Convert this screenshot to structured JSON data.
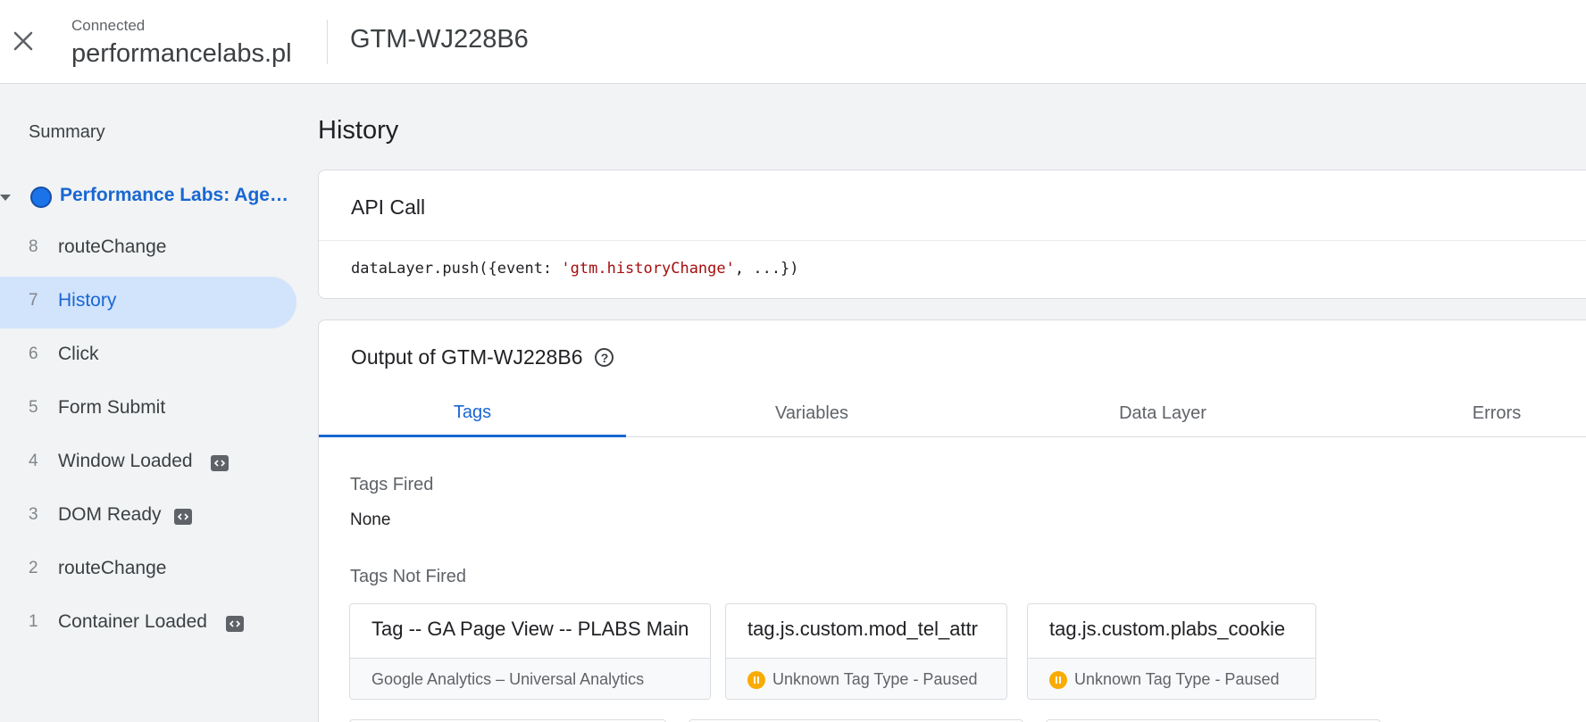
{
  "header": {
    "status": "Connected",
    "site": "performancelabs.pl",
    "container_id": "GTM-WJ228B6"
  },
  "sidebar": {
    "summary": "Summary",
    "page": "Performance Labs: Agencja Performance Marketingu",
    "events": [
      {
        "num": "8",
        "label": "routeChange"
      },
      {
        "num": "7",
        "label": "History"
      },
      {
        "num": "6",
        "label": "Click"
      },
      {
        "num": "5",
        "label": "Form Submit"
      },
      {
        "num": "4",
        "label": "Window Loaded"
      },
      {
        "num": "3",
        "label": "DOM Ready"
      },
      {
        "num": "2",
        "label": "routeChange"
      },
      {
        "num": "1",
        "label": "Container Loaded"
      }
    ]
  },
  "main": {
    "title": "History",
    "api": {
      "title": "API Call",
      "code_prefix": "dataLayer.push({event: ",
      "code_string": "'gtm.historyChange'",
      "code_suffix": ", ...})"
    },
    "output": {
      "title": "Output of GTM-WJ228B6",
      "help": "?",
      "tabs": [
        "Tags",
        "Variables",
        "Data Layer",
        "Errors"
      ],
      "fired_label": "Tags Fired",
      "fired_value": "None",
      "not_fired_label": "Tags Not Fired",
      "tags": [
        {
          "name": "Tag -- GA Page View -- PLABS Main",
          "type": "Google Analytics – Universal Analytics"
        },
        {
          "name": "tag.js.custom.mod_tel_attr",
          "type": "Unknown Tag Type - Paused"
        },
        {
          "name": "tag.js.custom.plabs_cookie",
          "type": "Unknown Tag Type - Paused"
        }
      ]
    }
  },
  "colors": {
    "accent": "#1967d2",
    "selected_bg": "#d2e3fc",
    "paused": "#f9ab00",
    "code_string": "#a50e0e"
  }
}
